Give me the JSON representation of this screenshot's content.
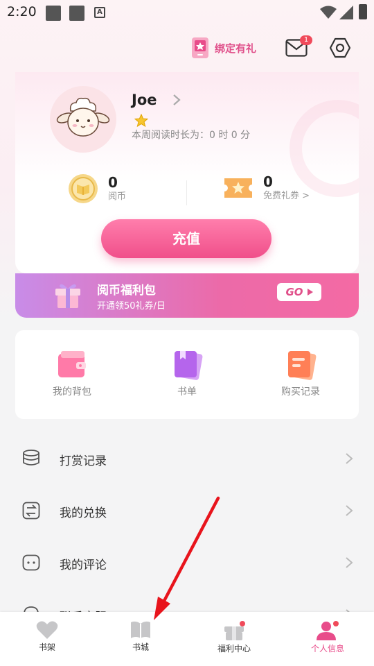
{
  "status_bar": {
    "time": "2:20",
    "a_icon": "A"
  },
  "header": {
    "bind_gift_label": "绑定有礼",
    "mail_badge": "1"
  },
  "profile": {
    "username": "Joe",
    "read_time_text": "本周阅读时长为：0 时 0 分",
    "coins": {
      "value": "0",
      "label": "阅币"
    },
    "tickets": {
      "value": "0",
      "label": "免费礼券 >"
    },
    "recharge_label": "充值"
  },
  "welfare": {
    "title": "阅币福利包",
    "subtitle": "开通领50礼券/日",
    "go_label": "GO"
  },
  "quick_actions": [
    {
      "label": "我的背包",
      "icon": "wallet-icon"
    },
    {
      "label": "书单",
      "icon": "booklist-icon"
    },
    {
      "label": "购买记录",
      "icon": "purchase-record-icon"
    }
  ],
  "menu": [
    {
      "label": "打赏记录",
      "icon": "coin-stack-icon"
    },
    {
      "label": "我的兑换",
      "icon": "exchange-icon"
    },
    {
      "label": "我的评论",
      "icon": "comment-icon"
    },
    {
      "label": "联系客服",
      "icon": "headset-icon"
    }
  ],
  "bottom_nav": [
    {
      "label": "书架",
      "icon": "heart-icon"
    },
    {
      "label": "书城",
      "icon": "book-icon"
    },
    {
      "label": "福利中心",
      "icon": "gift-icon"
    },
    {
      "label": "个人信息",
      "icon": "person-icon",
      "active": true
    }
  ],
  "colors": {
    "accent": "#e84c8a",
    "badge": "#f04a5a",
    "banner_start": "#c88ce8",
    "banner_end": "#f46aa4"
  }
}
